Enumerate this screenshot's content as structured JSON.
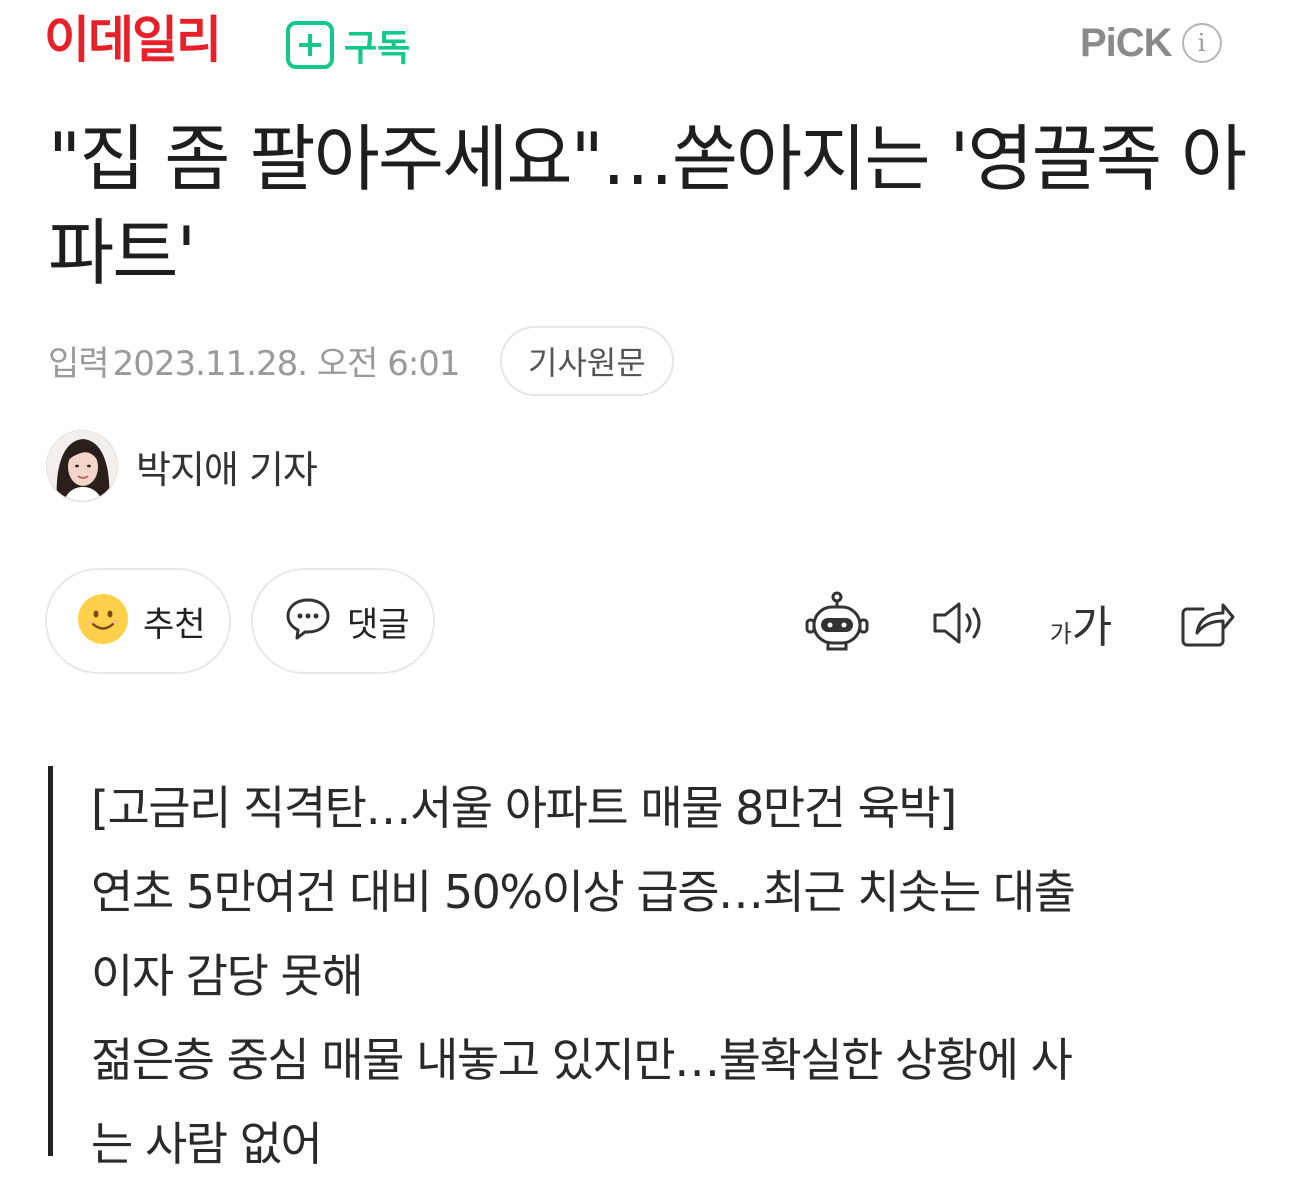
{
  "header": {
    "logo": "이데일리",
    "subscribe_label": "구독",
    "pick_label": "PiCK",
    "info_label": "i",
    "colors": {
      "logo": "#e8202a",
      "subscribe": "#13c98a"
    }
  },
  "article": {
    "title": "\"집 좀 팔아주세요\"…쏟아지는 '영끌족 아파트'",
    "date_label": "입력",
    "date_value": "2023.11.28. 오전 6:01",
    "original_button": "기사원문",
    "reporter": "박지애 기자"
  },
  "actions": {
    "like_label": "추천",
    "comment_label": "댓글",
    "font_small": "가",
    "font_large": "가",
    "icons": [
      "smile-icon",
      "comment-icon",
      "robot-icon",
      "speaker-icon",
      "font-size-icon",
      "share-icon"
    ]
  },
  "summary": {
    "lines": [
      "[고금리 직격탄…서울 아파트 매물 8만건 육박]",
      "연초 5만여건 대비 50%이상 급증…최근 치솟는 대출",
      "이자 감당 못해",
      "젊은층 중심 매물 내놓고 있지만…불확실한 상황에 사",
      "는 사람 없어"
    ]
  }
}
